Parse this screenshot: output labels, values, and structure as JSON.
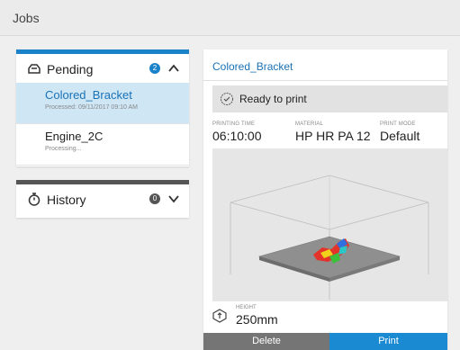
{
  "header": {
    "title": "Jobs"
  },
  "pending": {
    "label": "Pending",
    "count": "2",
    "jobs": [
      {
        "name": "Colored_Bracket",
        "sub": "Processed: 09/11/2017 09:10 AM"
      },
      {
        "name": "Engine_2C",
        "sub": "Processing..."
      }
    ]
  },
  "history": {
    "label": "History",
    "count": "0"
  },
  "detail": {
    "name": "Colored_Bracket",
    "status": "Ready to print",
    "printing_time_label": "PRINTING TIME",
    "printing_time": "06:10:00",
    "material_label": "MATERIAL",
    "material": "HP HR PA 12",
    "print_mode_label": "PRINT MODE",
    "print_mode": "Default",
    "height_label": "HEIGHT",
    "height": "250mm"
  },
  "actions": {
    "delete": "Delete",
    "print": "Print"
  },
  "colors": {
    "accent": "#1a82c8",
    "selected_bg": "#cfe6f5",
    "delete_bg": "#757575",
    "print_bg": "#1a8ad3"
  },
  "icons": {
    "pending": "printer-icon",
    "history": "stopwatch-icon",
    "status": "check-circle-icon",
    "height": "cube-height-icon"
  }
}
